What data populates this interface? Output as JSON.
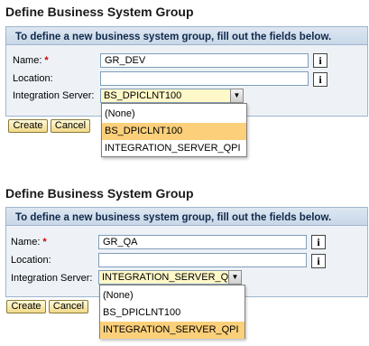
{
  "title": "Define Business System Group",
  "instruction": "To define a new business system group, fill out the fields below.",
  "labels": {
    "name": "Name:",
    "required": "*",
    "location": "Location:",
    "integration_server": "Integration Server:"
  },
  "buttons": {
    "create": "Create",
    "cancel": "Cancel"
  },
  "icons": {
    "info": "info-icon",
    "dropdown": "triangle-down-icon"
  },
  "forms": [
    {
      "name_value": "GR_DEV",
      "location_value": "",
      "integration_server_value": "BS_DPICLNT100",
      "options": [
        "(None)",
        "BS_DPICLNT100",
        "INTEGRATION_SERVER_QPI"
      ],
      "selected_option": "BS_DPICLNT100"
    },
    {
      "name_value": "GR_QA",
      "location_value": "",
      "integration_server_value": "INTEGRATION_SERVER_QPI",
      "options": [
        "(None)",
        "BS_DPICLNT100",
        "INTEGRATION_SERVER_QPI"
      ],
      "selected_option": "INTEGRATION_SERVER_QPI"
    }
  ],
  "colors": {
    "selected_option": "#fcd07a",
    "select_background": "#fff8c8",
    "required_marker": "#cc0000",
    "panel_background": "#eef2f7"
  }
}
